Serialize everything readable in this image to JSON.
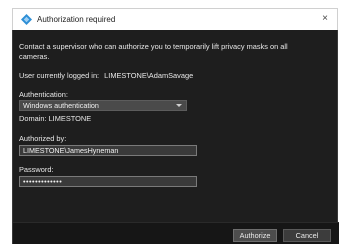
{
  "window": {
    "title": "Authorization required",
    "close_glyph": "×",
    "icon": "milestone-diamond-icon",
    "icon_color": "#2e8fd6"
  },
  "content": {
    "message": "Contact a supervisor who can authorize you to temporarily lift privacy masks on all cameras.",
    "logged_in_label": "User currently logged in:",
    "logged_in_user": "LIMESTONE\\AdamSavage",
    "authentication_label": "Authentication:",
    "authentication_value": "Windows authentication",
    "domain_text": "Domain: LIMESTONE",
    "authorized_by_label": "Authorized by:",
    "authorized_by_value": "LIMESTONE\\JamesHyneman",
    "password_label": "Password:",
    "password_value": "•••••••••••••"
  },
  "buttons": {
    "authorize": "Authorize",
    "cancel": "Cancel"
  },
  "colors": {
    "dialog_bg": "#1e1e1e",
    "footer_bg": "#161616",
    "text": "#e8e8e8"
  }
}
